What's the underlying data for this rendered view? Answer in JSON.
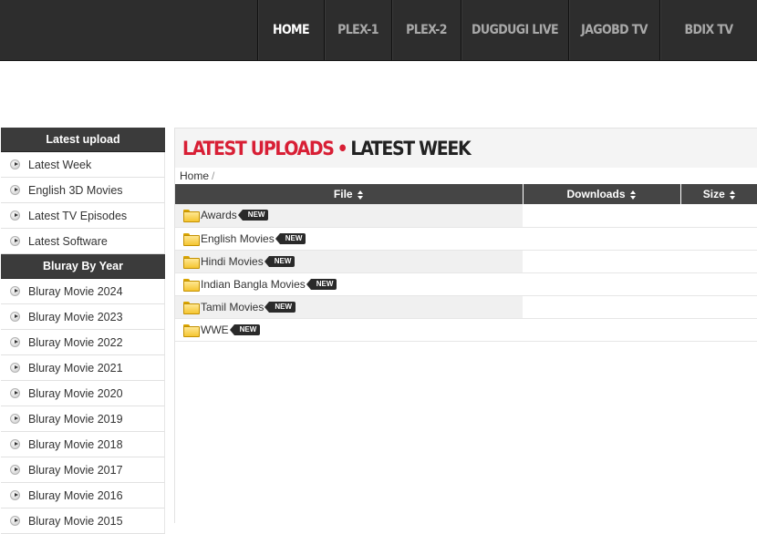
{
  "nav": {
    "items": [
      {
        "label": "HOME",
        "active": true,
        "width": 73
      },
      {
        "label": "PLEX-1",
        "active": false,
        "width": 74
      },
      {
        "label": "PLEX-2",
        "active": false,
        "width": 76
      },
      {
        "label": "DUGDUGI LIVE",
        "active": false,
        "width": 118
      },
      {
        "label": "JAGOBD TV",
        "active": false,
        "width": 100
      },
      {
        "label": "BDIX TV",
        "active": false,
        "width": 107
      }
    ]
  },
  "sidebar": {
    "sections": [
      {
        "title": "Latest upload",
        "items": [
          "Latest Week",
          "English 3D Movies",
          "Latest TV Episodes",
          "Latest Software"
        ]
      },
      {
        "title": "Bluray By Year",
        "items": [
          "Bluray Movie 2024",
          "Bluray Movie 2023",
          "Bluray Movie 2022",
          "Bluray Movie 2021",
          "Bluray Movie 2020",
          "Bluray Movie 2019",
          "Bluray Movie 2018",
          "Bluray Movie 2017",
          "Bluray Movie 2016",
          "Bluray Movie 2015"
        ]
      }
    ]
  },
  "main": {
    "heading_red": "LATEST UPLOADS",
    "heading_sep": "•",
    "heading_dark": "LATEST WEEK",
    "breadcrumb": {
      "home": "Home",
      "sep": "/"
    },
    "table": {
      "columns": [
        "File",
        "Downloads",
        "Size"
      ],
      "rows": [
        {
          "name": "Awards",
          "badge": "NEW"
        },
        {
          "name": "English Movies",
          "badge": "NEW"
        },
        {
          "name": "Hindi Movies",
          "badge": "NEW"
        },
        {
          "name": "Indian Bangla Movies",
          "badge": "NEW"
        },
        {
          "name": "Tamil Movies",
          "badge": "NEW"
        },
        {
          "name": "WWE",
          "badge": "NEW"
        }
      ]
    }
  },
  "colors": {
    "accent": "#d81f35",
    "topbar": "#2d2d2d",
    "sidebar_header": "#3b3b3b",
    "table_header": "#454545"
  },
  "icons": {
    "folder": "folder-icon",
    "bullet": "arrow-bullet-icon",
    "sort": "sort-icon"
  }
}
